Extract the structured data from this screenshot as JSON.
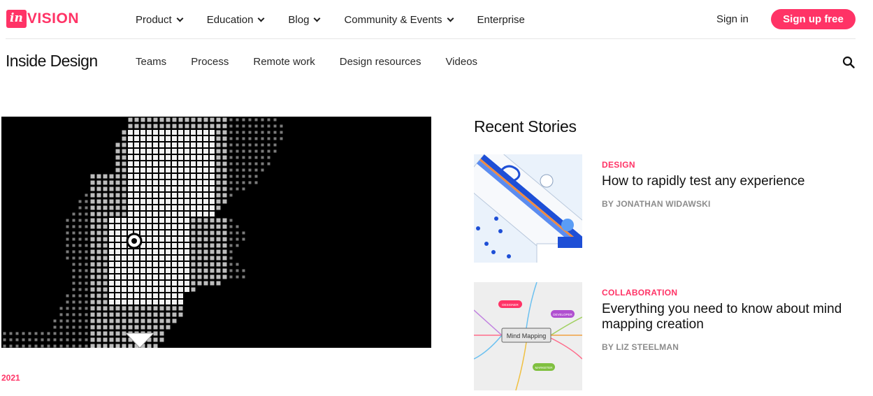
{
  "logo": {
    "mark": "in",
    "word": "VISION"
  },
  "topnav": {
    "items": [
      {
        "label": "Product",
        "dropdown": true
      },
      {
        "label": "Education",
        "dropdown": true
      },
      {
        "label": "Blog",
        "dropdown": true
      },
      {
        "label": "Community & Events",
        "dropdown": true
      },
      {
        "label": "Enterprise",
        "dropdown": false
      }
    ],
    "signin": "Sign in",
    "signup": "Sign up free"
  },
  "subnav": {
    "brand": "Inside Design",
    "items": [
      "Teams",
      "Process",
      "Remote work",
      "Design resources",
      "Videos"
    ],
    "search_icon": "search-icon"
  },
  "hero": {
    "year": "2021"
  },
  "recent": {
    "title": "Recent Stories",
    "stories": [
      {
        "category": "DESIGN",
        "title": "How to rapidly test any experience",
        "byline": "BY JONATHAN WIDAWSKI"
      },
      {
        "category": "COLLABORATION",
        "title": "Everything you need to know about mind mapping creation",
        "byline": "BY LIZ STEELMAN",
        "thumb_labels": {
          "center": "Mind Mapping",
          "n1": "DESIGNER",
          "n2": "DEVELOPER",
          "n3": "MARKETER"
        }
      }
    ]
  },
  "colors": {
    "brand": "#ff3366",
    "muted": "#8c8c8c"
  }
}
